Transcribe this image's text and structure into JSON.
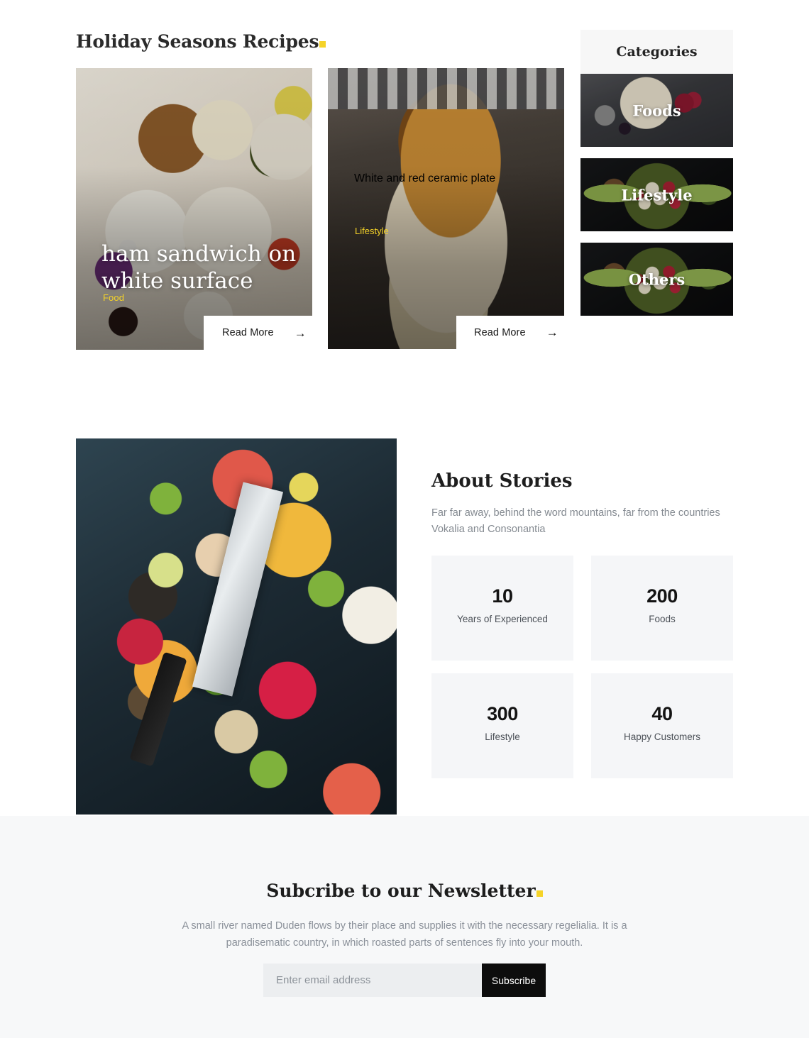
{
  "recipes": {
    "title": "Holiday Seasons Recipes",
    "posts": [
      {
        "category": "Food",
        "title": "ham sandwich on white surface",
        "read_more": "Read More",
        "arrow": "→"
      },
      {
        "category": "Lifestyle",
        "title": "White and red ceramic plate",
        "read_more": "Read More",
        "arrow": "→"
      }
    ]
  },
  "categories": {
    "heading": "Categories",
    "items": [
      {
        "label": "Foods"
      },
      {
        "label": "Lifestyle"
      },
      {
        "label": "Others"
      }
    ]
  },
  "about": {
    "heading": "About Stories",
    "copy": "Far far away, behind the word mountains, far from the countries Vokalia and Consonantia",
    "stats": [
      {
        "number": "10",
        "label": "Years of Experienced"
      },
      {
        "number": "200",
        "label": "Foods"
      },
      {
        "number": "300",
        "label": "Lifestyle"
      },
      {
        "number": "40",
        "label": "Happy Customers"
      }
    ]
  },
  "newsletter": {
    "title": "Subcribe to our Newsletter",
    "copy": "A small river named Duden flows by their place and supplies it with the necessary regelialia. It is a paradisematic country, in which roasted parts of sentences fly into your mouth.",
    "email_placeholder": "Enter email address",
    "email_value": "",
    "submit_label": "Subscribe"
  },
  "colors": {
    "accent_yellow": "#f5d328",
    "dark": "#0d0d0d",
    "muted_text": "#8a9099",
    "panel_bg": "#f5f6f8",
    "section_bg": "#f7f8f9"
  }
}
